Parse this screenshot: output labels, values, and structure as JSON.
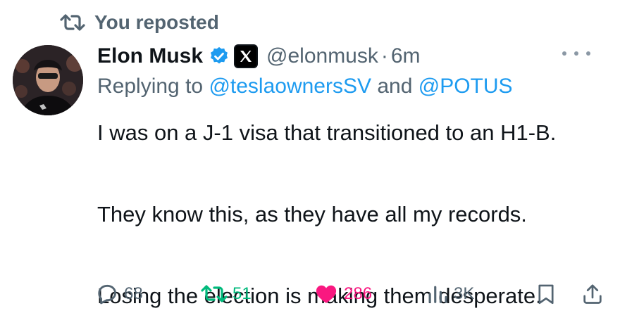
{
  "repost_banner": {
    "icon": "repost-icon",
    "text": "You reposted"
  },
  "author": {
    "name": "Elon Musk",
    "verified": true,
    "badge_color": "#1d9bf0",
    "affiliate_badge": "x-logo",
    "handle": "@elonmusk",
    "separator": "·",
    "time": "6m"
  },
  "replying": {
    "prefix": "Replying to ",
    "mention1": "@teslaownersSV",
    "conjunction": " and ",
    "mention2": "@POTUS"
  },
  "tweet": {
    "lines": [
      "I was on a J-1 visa that transitioned to an H1-B.",
      "They know this, as they have all my records.",
      "Losing the election is making them desperate."
    ]
  },
  "actions": {
    "reply_count": "68",
    "repost_count": "51",
    "like_count": "286",
    "views_count": "3K",
    "repost_color": "#00ba7c",
    "like_color": "#f91880"
  }
}
